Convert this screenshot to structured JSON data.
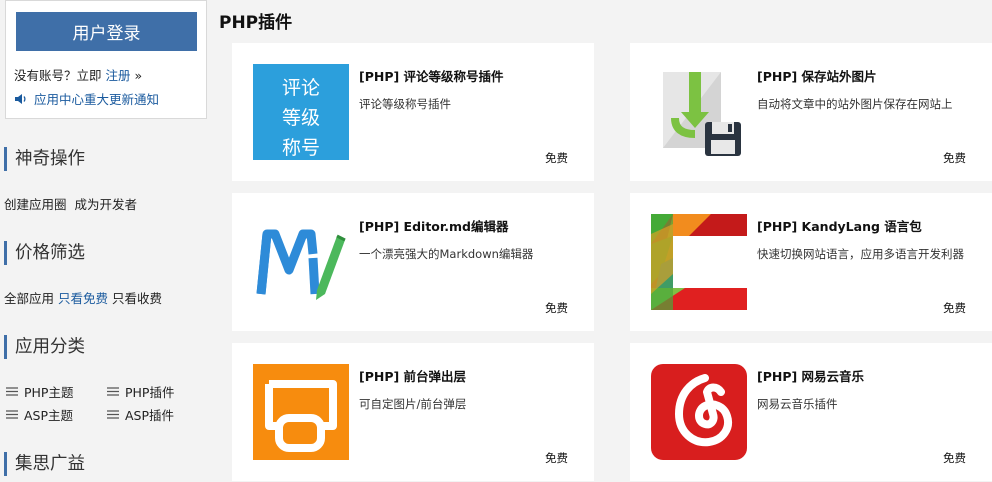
{
  "sidebar": {
    "login_button": "用户登录",
    "register_prefix": "没有账号？立即",
    "register_link": "注册",
    "register_suffix": "»",
    "notice": "应用中心重大更新通知",
    "sections": {
      "magic": {
        "title": "神奇操作",
        "links": [
          "创建应用圈",
          "成为开发者"
        ]
      },
      "price": {
        "title": "价格筛选",
        "links": [
          "全部应用",
          "只看免费",
          "只看收费"
        ],
        "active_index": 1
      },
      "category": {
        "title": "应用分类",
        "items": [
          "PHP主题",
          "PHP插件",
          "ASP主题",
          "ASP插件"
        ]
      },
      "ads": {
        "title": "集思广益"
      }
    }
  },
  "main": {
    "title": "PHP插件",
    "cards": [
      {
        "title": "[PHP] 评论等级称号插件",
        "desc": "评论等级称号插件",
        "price": "免费",
        "thumb_text": [
          "评论",
          "等级",
          "称号"
        ],
        "thumb_color": "#2c9fdc"
      },
      {
        "title": "[PHP] 保存站外图片",
        "desc": "自动将文章中的站外图片保存在网站上",
        "price": "免费",
        "thumb_icon": "save-image-icon"
      },
      {
        "title": "[PHP] Editor.md编辑器",
        "desc": "一个漂亮强大的Markdown编辑器",
        "price": "免费",
        "thumb_icon": "markdown-m-pencil-icon"
      },
      {
        "title": "[PHP] KandyLang 语言包",
        "desc": "快速切换网站语言，应用多语言开发利器",
        "price": "免费",
        "thumb_icon": "colorful-l-icon"
      },
      {
        "title": "[PHP] 前台弹出层",
        "desc": "可自定图片/前台弹层",
        "price": "免费",
        "thumb_icon": "popup-layer-icon",
        "thumb_color": "#f78c0e"
      },
      {
        "title": "[PHP] 网易云音乐",
        "desc": "网易云音乐插件",
        "price": "免费",
        "thumb_icon": "netease-music-icon",
        "thumb_color": "#d81e1e"
      }
    ]
  }
}
